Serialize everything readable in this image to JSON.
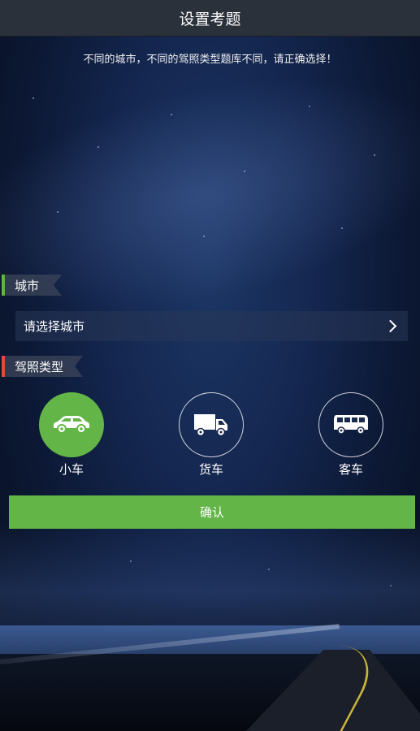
{
  "header": {
    "title": "设置考题"
  },
  "notice": "不同的城市，不同的驾照类型题库不同，请正确选择！",
  "city_section": {
    "label": "城市",
    "select_placeholder": "请选择城市"
  },
  "license_section": {
    "label": "驾照类型"
  },
  "vehicles": [
    {
      "label": "小车",
      "icon": "car-icon",
      "selected": true
    },
    {
      "label": "货车",
      "icon": "truck-icon",
      "selected": false
    },
    {
      "label": "客车",
      "icon": "bus-icon",
      "selected": false
    }
  ],
  "confirm_label": "确认",
  "colors": {
    "accent": "#62b546",
    "city_tag": "#5db548",
    "license_tag": "#e24b3b",
    "titlebar": "#2b313b"
  }
}
